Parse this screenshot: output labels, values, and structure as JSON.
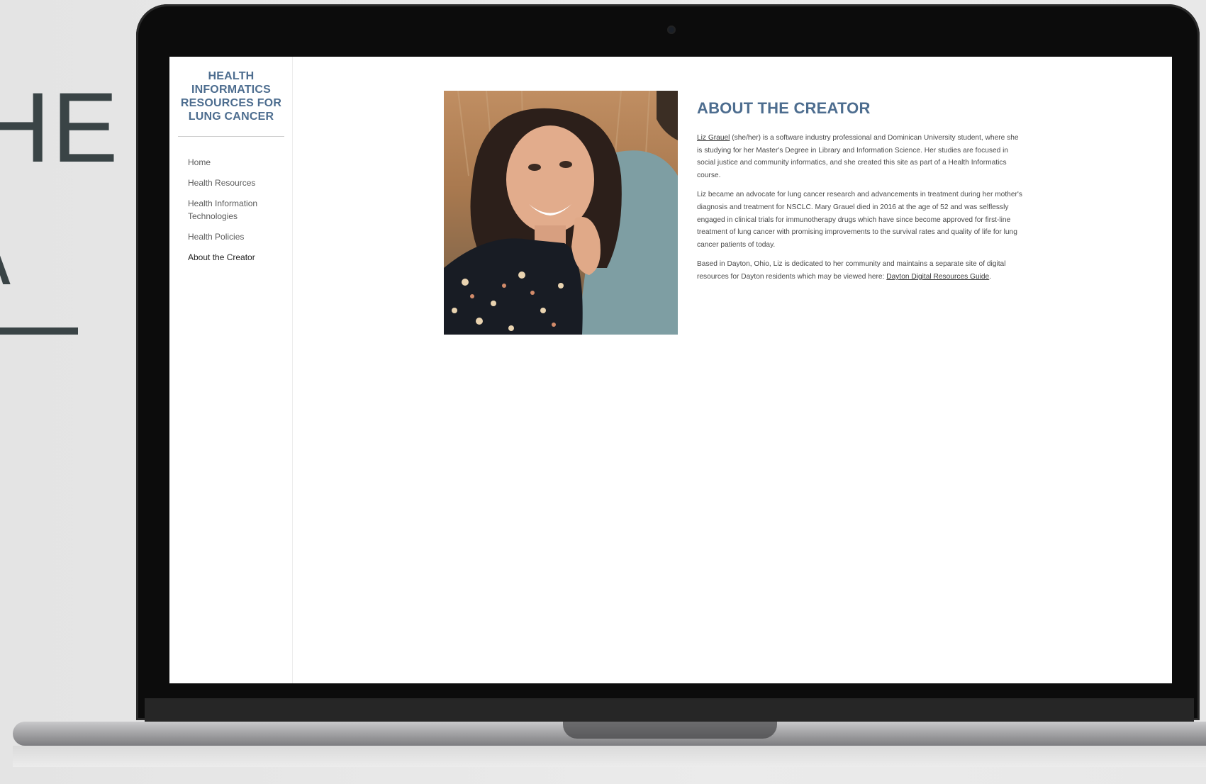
{
  "slide": {
    "partial_heading": "HE",
    "partial_glyph": "ʌ"
  },
  "site": {
    "title": "HEALTH INFORMATICS RESOURCES FOR LUNG CANCER",
    "nav": [
      {
        "label": "Home",
        "active": false
      },
      {
        "label": "Health Resources",
        "active": false
      },
      {
        "label": "Health Information Technologies",
        "active": false
      },
      {
        "label": "Health Policies",
        "active": false
      },
      {
        "label": "About the Creator",
        "active": true
      }
    ]
  },
  "page": {
    "heading": "ABOUT THE CREATOR",
    "p1_link": "Liz Grauel",
    "p1_text": " (she/her) is a software industry professional and Dominican University student, where she is studying for her Master's Degree in Library and Information Science. Her studies are focused in social justice and community informatics, and she created this site as part of a Health Informatics course.",
    "p2_text": "Liz became an advocate for lung cancer research and advancements in treatment during her mother's diagnosis and treatment for NSCLC. Mary Grauel died in 2016 at the age of 52 and was selflessly engaged in clinical trials for immunotherapy drugs which have since become approved for first-line treatment of lung cancer with promising improvements to the survival rates and quality of life for lung cancer patients of today.",
    "p3_text": "Based in Dayton, Ohio, Liz is dedicated to her community and maintains a separate site of digital resources for Dayton residents which may be viewed here: ",
    "p3_link": "Dayton Digital Resources Guide",
    "p3_end": "."
  },
  "colors": {
    "accent": "#4d6d8f",
    "body_text": "#4a4a4a",
    "laptop_frame": "#0c0c0c"
  }
}
